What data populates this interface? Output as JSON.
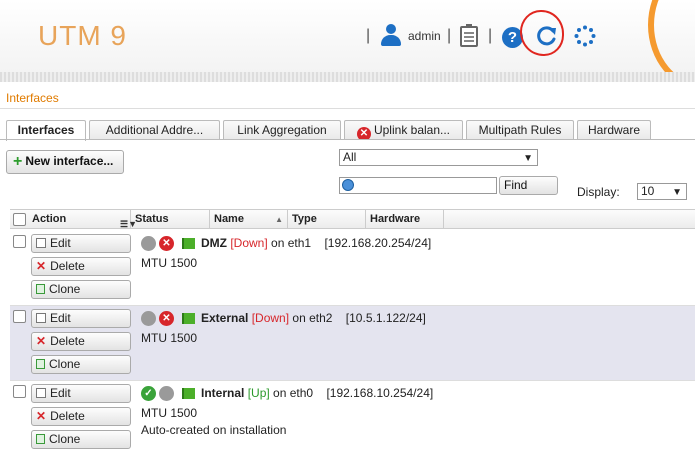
{
  "header": {
    "brand": "UTM 9",
    "user": "admin",
    "icons": [
      "user-icon",
      "clipboard-icon",
      "help-icon",
      "refresh-icon",
      "spinner-icon"
    ],
    "accent_color": "#f59a2f"
  },
  "page": {
    "title": "Interfaces"
  },
  "tabs": [
    {
      "label": "Interfaces",
      "active": true
    },
    {
      "label": "Additional Addre..."
    },
    {
      "label": "Link Aggregation"
    },
    {
      "label": "Uplink balan...",
      "icon": "error-icon"
    },
    {
      "label": "Multipath Rules"
    },
    {
      "label": "Hardware"
    }
  ],
  "toolbar": {
    "new_label": "New interface...",
    "filter_value": "All",
    "search_placeholder": "",
    "find_label": "Find",
    "display_label": "Display:",
    "display_value": "10"
  },
  "table": {
    "columns": [
      "Action",
      "Status",
      "Name",
      "Type",
      "Hardware"
    ],
    "actions": {
      "edit": "Edit",
      "delete": "Delete",
      "clone": "Clone"
    },
    "rows": [
      {
        "name": "DMZ",
        "state": "[Down]",
        "on": "on eth1",
        "address": "[192.168.20.254/24]",
        "mtu": "MTU 1500",
        "note": "",
        "status": "down"
      },
      {
        "name": "External",
        "state": "[Down]",
        "on": "on eth2",
        "address": "[10.5.1.122/24]",
        "mtu": "MTU 1500",
        "note": "",
        "status": "down"
      },
      {
        "name": "Internal",
        "state": "[Up]",
        "on": "on eth0",
        "address": "[192.168.10.254/24]",
        "mtu": "MTU 1500",
        "note": "Auto-created on installation",
        "status": "up"
      }
    ]
  }
}
